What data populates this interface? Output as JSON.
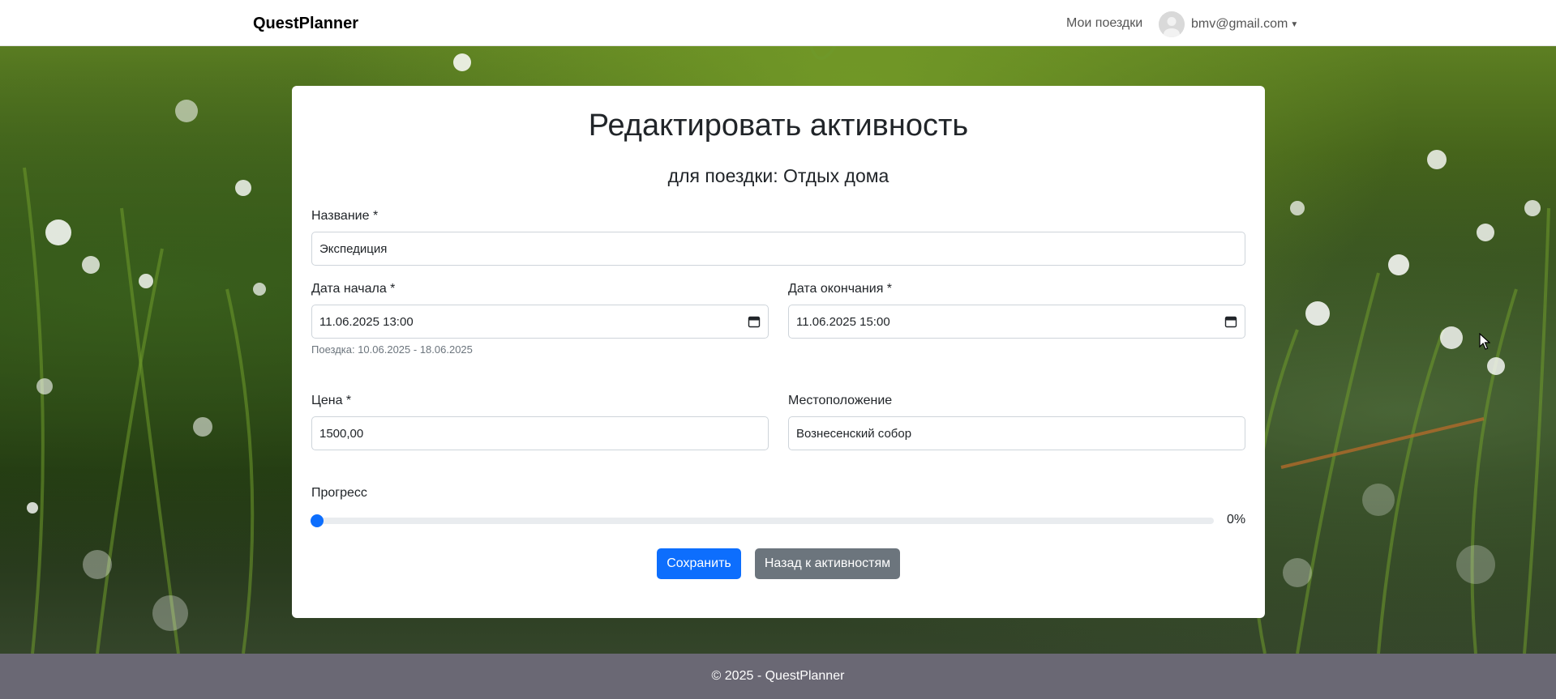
{
  "navbar": {
    "brand": "QuestPlanner",
    "my_trips": "Мои поездки",
    "user_email": "bmv@gmail.com",
    "caret_icon": "caret-down-icon",
    "avatar_icon": "user-avatar-icon"
  },
  "form": {
    "title": "Редактировать активность",
    "subtitle": "для поездки: Отдых дома",
    "name": {
      "label": "Название *",
      "value": "Экспедиция"
    },
    "start_date": {
      "label": "Дата начала *",
      "value": "11.06.2025 13:00",
      "icon": "calendar-icon"
    },
    "end_date": {
      "label": "Дата окончания *",
      "value": "11.06.2025 15:00",
      "icon": "calendar-icon"
    },
    "trip_range_hint": "Поездка: 10.06.2025 - 18.06.2025",
    "price": {
      "label": "Цена *",
      "value": "1500,00"
    },
    "location": {
      "label": "Местоположение",
      "value": "Вознесенский собор"
    },
    "progress": {
      "label": "Прогресс",
      "value": 0,
      "display": "0%"
    },
    "save_label": "Сохранить",
    "back_label": "Назад к активностям"
  },
  "footer": {
    "text": "© 2025 - QuestPlanner"
  },
  "colors": {
    "primary": "#0d6efd",
    "secondary": "#6c757d",
    "footer_bg": "#6a6874"
  }
}
